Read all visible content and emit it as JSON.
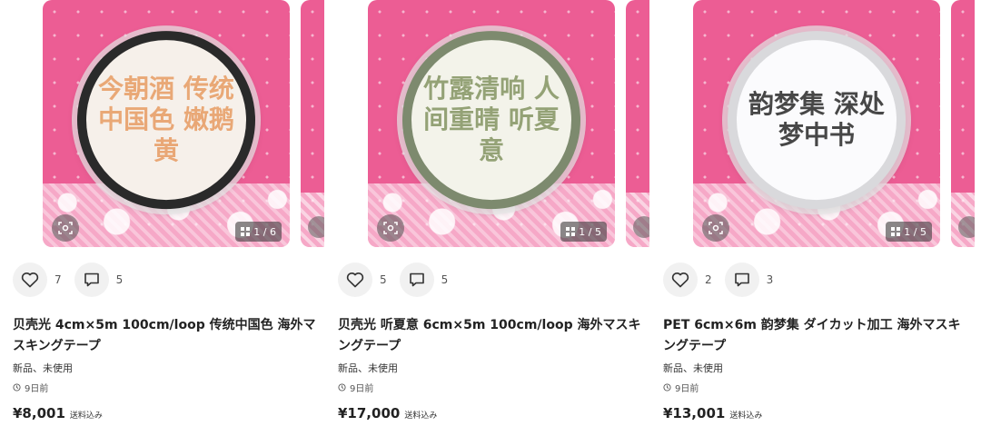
{
  "listings": [
    {
      "image_label_glyphs": "今朝酒 传统中国色 嫩鹅黄",
      "counter": "1 / 6",
      "likes": "7",
      "comments": "5",
      "title": "贝壳光 4cm×5m 100cm/loop 传统中国色 海外マスキングテープ",
      "condition": "新品、未使用",
      "time": "9日前",
      "price": "¥8,001",
      "shipping": "送料込み",
      "tape_color": "#e8a06a"
    },
    {
      "image_label_glyphs": "竹露清响 人间重晴 听夏意",
      "counter": "1 / 5",
      "likes": "5",
      "comments": "5",
      "title": "贝壳光 听夏意 6cm×5m 100cm/loop 海外マスキングテープ",
      "condition": "新品、未使用",
      "time": "9日前",
      "price": "¥17,000",
      "shipping": "送料込み",
      "tape_color": "#8a9a6a"
    },
    {
      "image_label_glyphs": "韵梦集 深处 梦中书",
      "counter": "1 / 5",
      "likes": "2",
      "comments": "3",
      "title": "PET 6cm×6m 韵梦集 ダイカット加工 海外マスキングテープ",
      "condition": "新品、未使用",
      "time": "9日前",
      "price": "¥13,001",
      "shipping": "送料込み",
      "tape_color": "#333333"
    }
  ],
  "icons": {
    "like": "heart-icon",
    "comment": "comment-bubble-icon",
    "scan": "image-search-icon",
    "gallery": "grid-icon",
    "clock": "clock-icon"
  }
}
